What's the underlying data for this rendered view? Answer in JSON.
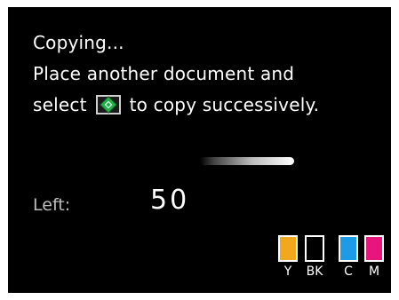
{
  "message": {
    "line1": "Copying...",
    "line2": "Place another document and",
    "line3_pre": "select",
    "line3_post": "to copy successively."
  },
  "start_button_icon": "start-diamond-icon",
  "copy_progress": {
    "state": "in progress"
  },
  "remaining": {
    "label": "Left:",
    "value": "50"
  },
  "ink": [
    {
      "label": "Y",
      "color": "#f2a81d"
    },
    {
      "label": "BK",
      "color": "#000000"
    },
    {
      "label": "C",
      "color": "#1e9be6"
    },
    {
      "label": "M",
      "color": "#e8157c"
    }
  ]
}
